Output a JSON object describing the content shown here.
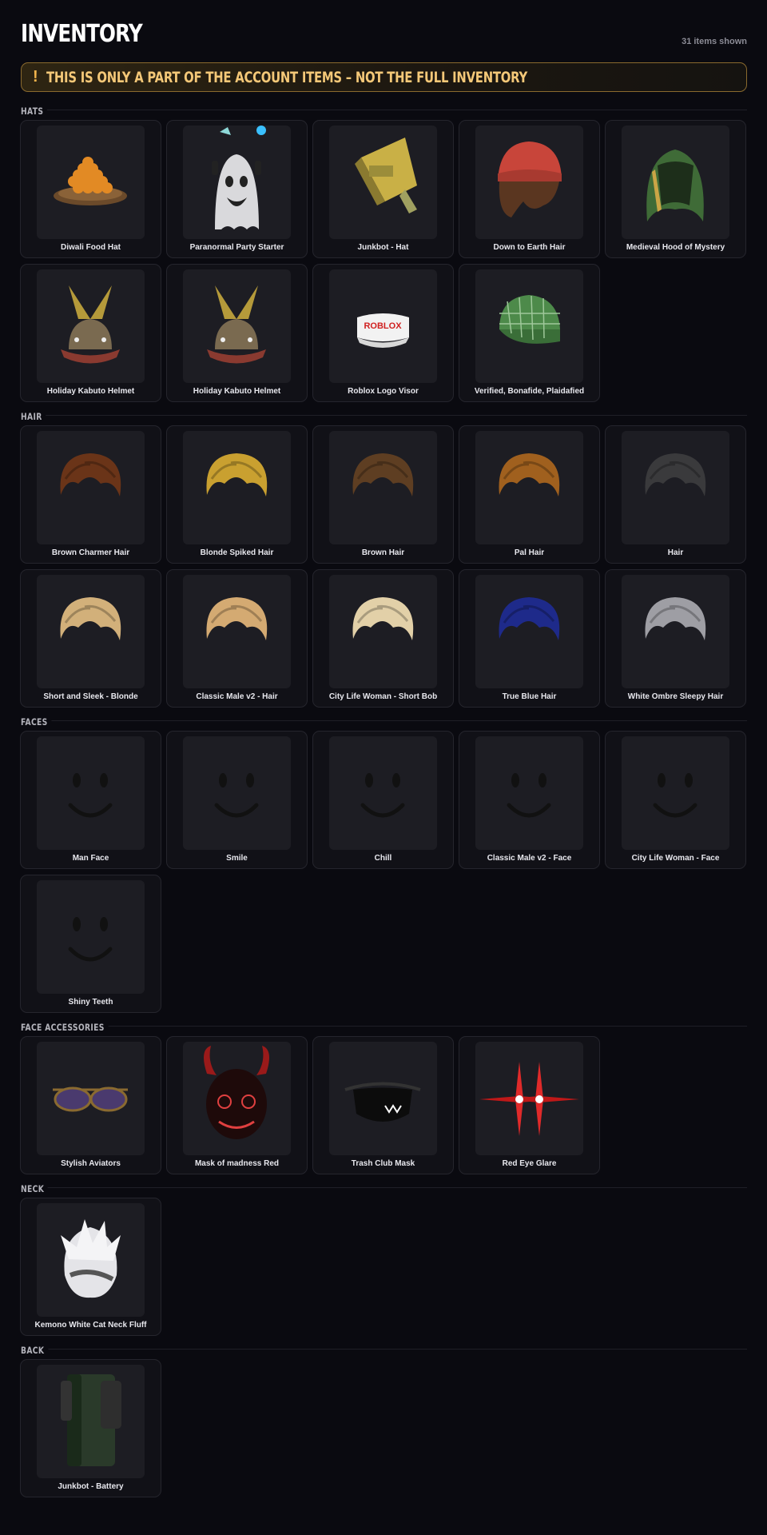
{
  "header": {
    "title": "INVENTORY",
    "count": "31 items shown"
  },
  "banner": {
    "mark": "!",
    "text": "THIS IS ONLY A PART OF THE ACCOUNT ITEMS – NOT THE FULL INVENTORY"
  },
  "colors": {
    "accent": "#f4c878",
    "banner_border": "#8a6a2e",
    "card_bg": "#111117",
    "page_bg": "#0a0a10"
  },
  "sections": [
    {
      "label": "HATS",
      "items": [
        {
          "name": "Diwali Food Hat",
          "icon": "diwali-food-hat-icon"
        },
        {
          "name": "Paranormal Party Starter",
          "icon": "ghost-hat-icon"
        },
        {
          "name": "Junkbot - Hat",
          "icon": "junkbot-hat-icon"
        },
        {
          "name": "Down to Earth Hair",
          "icon": "beanie-hair-icon"
        },
        {
          "name": "Medieval Hood of Mystery",
          "icon": "green-hood-icon"
        },
        {
          "name": "Holiday Kabuto Helmet",
          "icon": "kabuto-helmet-icon"
        },
        {
          "name": "Holiday Kabuto Helmet",
          "icon": "kabuto-helmet-icon"
        },
        {
          "name": "Roblox Logo Visor",
          "icon": "visor-icon"
        },
        {
          "name": "Verified, Bonafide, Plaidafied",
          "icon": "plaid-cap-icon"
        }
      ]
    },
    {
      "label": "HAIR",
      "items": [
        {
          "name": "Brown Charmer Hair",
          "icon": "hair-icon"
        },
        {
          "name": "Blonde Spiked Hair",
          "icon": "hair-icon"
        },
        {
          "name": "Brown Hair",
          "icon": "hair-icon"
        },
        {
          "name": "Pal Hair",
          "icon": "hair-icon"
        },
        {
          "name": "Hair",
          "icon": "hair-icon"
        },
        {
          "name": "Short and Sleek - Blonde",
          "icon": "hair-icon"
        },
        {
          "name": "Classic Male v2 - Hair",
          "icon": "hair-icon"
        },
        {
          "name": "City Life Woman - Short Bob",
          "icon": "hair-icon"
        },
        {
          "name": "True Blue Hair",
          "icon": "hair-icon"
        },
        {
          "name": "White Ombre Sleepy Hair",
          "icon": "hair-icon"
        }
      ]
    },
    {
      "label": "FACES",
      "items": [
        {
          "name": "Man Face",
          "icon": "face-icon"
        },
        {
          "name": "Smile",
          "icon": "face-icon"
        },
        {
          "name": "Chill",
          "icon": "face-icon"
        },
        {
          "name": "Classic Male v2 - Face",
          "icon": "face-icon"
        },
        {
          "name": "City Life Woman - Face",
          "icon": "face-icon"
        },
        {
          "name": "Shiny Teeth",
          "icon": "face-icon"
        }
      ]
    },
    {
      "label": "FACE ACCESSORIES",
      "items": [
        {
          "name": "Stylish Aviators",
          "icon": "sunglasses-icon"
        },
        {
          "name": "Mask of madness Red",
          "icon": "demon-mask-icon"
        },
        {
          "name": "Trash Club Mask",
          "icon": "mask-icon"
        },
        {
          "name": "Red Eye Glare",
          "icon": "eye-glare-icon"
        }
      ]
    },
    {
      "label": "NECK",
      "items": [
        {
          "name": "Kemono White Cat Neck Fluff",
          "icon": "neck-fluff-icon"
        }
      ]
    },
    {
      "label": "BACK",
      "items": [
        {
          "name": "Junkbot - Battery",
          "icon": "battery-icon"
        }
      ]
    }
  ]
}
